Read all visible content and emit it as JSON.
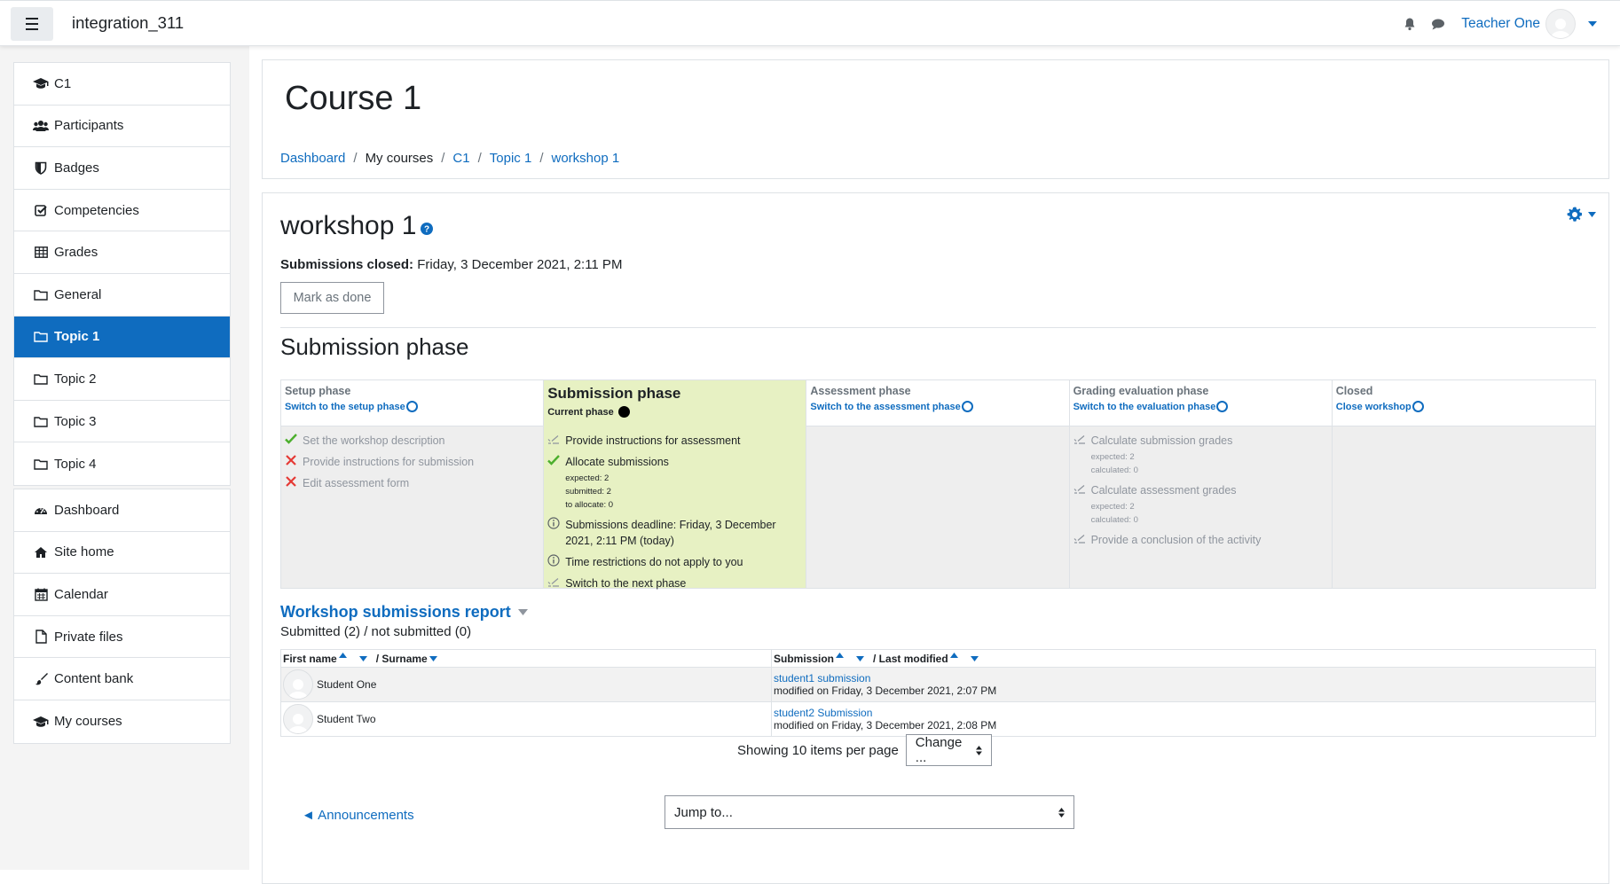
{
  "navbar": {
    "site_name": "integration_311",
    "user_name": "Teacher One"
  },
  "sidebar": {
    "course_items": [
      {
        "label": "C1",
        "icon": "graduation-cap-icon"
      },
      {
        "label": "Participants",
        "icon": "users-icon"
      },
      {
        "label": "Badges",
        "icon": "shield-icon"
      },
      {
        "label": "Competencies",
        "icon": "checkbox-icon"
      },
      {
        "label": "Grades",
        "icon": "table-icon"
      },
      {
        "label": "General",
        "icon": "folder-icon"
      },
      {
        "label": "Topic 1",
        "icon": "folder-icon",
        "active": true
      },
      {
        "label": "Topic 2",
        "icon": "folder-icon"
      },
      {
        "label": "Topic 3",
        "icon": "folder-icon"
      },
      {
        "label": "Topic 4",
        "icon": "folder-icon"
      }
    ],
    "site_items": [
      {
        "label": "Dashboard",
        "icon": "dashboard-icon"
      },
      {
        "label": "Site home",
        "icon": "home-icon"
      },
      {
        "label": "Calendar",
        "icon": "calendar-icon"
      },
      {
        "label": "Private files",
        "icon": "file-icon"
      },
      {
        "label": "Content bank",
        "icon": "brush-icon"
      },
      {
        "label": "My courses",
        "icon": "graduation-cap-icon"
      }
    ]
  },
  "header": {
    "course_title": "Course 1",
    "breadcrumb": [
      "Dashboard",
      "My courses",
      "C1",
      "Topic 1",
      "workshop 1"
    ]
  },
  "workshop": {
    "title": "workshop 1",
    "submissions_closed_label": "Submissions closed:",
    "submissions_closed_value": "Friday, 3 December 2021, 2:11 PM",
    "mark_done_label": "Mark as done",
    "section_title": "Submission phase"
  },
  "phases": [
    {
      "name": "Setup phase",
      "action": "Switch to the setup phase",
      "tasks": [
        {
          "status": "done",
          "text": "Set the workshop description"
        },
        {
          "status": "fail",
          "text": "Provide instructions for submission"
        },
        {
          "status": "fail",
          "text": "Edit assessment form"
        }
      ]
    },
    {
      "name": "Submission phase",
      "action": "Current phase",
      "current": true,
      "tasks": [
        {
          "status": "todo",
          "text": "Provide instructions for assessment"
        },
        {
          "status": "done",
          "text": "Allocate submissions",
          "details": [
            "expected: 2",
            "submitted: 2",
            "to allocate: 0"
          ]
        },
        {
          "status": "info",
          "text": "Submissions deadline: Friday, 3 December 2021, 2:11 PM (today)"
        },
        {
          "status": "info",
          "text": "Time restrictions do not apply to you"
        },
        {
          "status": "todo",
          "text": "Switch to the next phase"
        }
      ]
    },
    {
      "name": "Assessment phase",
      "action": "Switch to the assessment phase",
      "tasks": []
    },
    {
      "name": "Grading evaluation phase",
      "action": "Switch to the evaluation phase",
      "tasks": [
        {
          "status": "todo",
          "text": "Calculate submission grades",
          "details": [
            "expected: 2",
            "calculated: 0"
          ]
        },
        {
          "status": "todo",
          "text": "Calculate assessment grades",
          "details": [
            "expected: 2",
            "calculated: 0"
          ]
        },
        {
          "status": "todo",
          "text": "Provide a conclusion of the activity"
        }
      ]
    },
    {
      "name": "Closed",
      "action": "Close workshop",
      "tasks": []
    }
  ],
  "report": {
    "title": "Workshop submissions report",
    "summary": "Submitted (2) / not submitted (0)",
    "columns": {
      "first_name": "First name",
      "surname": "/ Surname",
      "submission": "Submission",
      "last_modified": "/ Last modified"
    },
    "rows": [
      {
        "student": "Student One",
        "submission": "student1 submission",
        "modified": "modified on Friday, 3 December 2021, 2:07 PM"
      },
      {
        "student": "Student Two",
        "submission": "student2 Submission",
        "modified": "modified on Friday, 3 December 2021, 2:08 PM"
      }
    ],
    "perpage_label": "Showing 10 items per page",
    "perpage_select": "Change ..."
  },
  "footer_nav": {
    "prev_link": "◄ Announcements",
    "jump_to": "Jump to..."
  },
  "colors": {
    "brand": "#0f6cbf",
    "current_phase_bg": "#e7f1c3",
    "done_green": "#4caf2d",
    "fail_red": "#e53935"
  }
}
